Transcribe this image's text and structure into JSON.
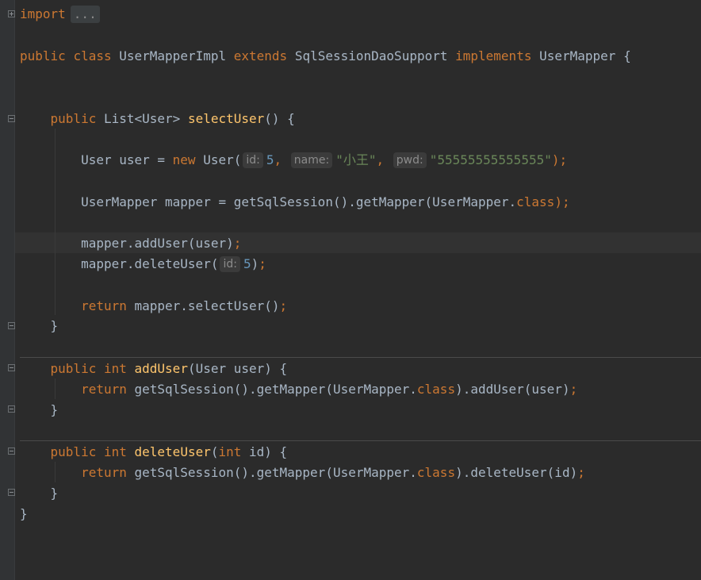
{
  "code": {
    "l_import_kw": "import",
    "l_import_fold": "...",
    "l_class_public": "public",
    "l_class_class": "class",
    "l_class_name": "UserMapperImpl",
    "l_class_extends": "extends",
    "l_class_super": "SqlSessionDaoSupport",
    "l_class_implements": "implements",
    "l_class_iface": "UserMapper",
    "l_class_brace": "{",
    "m1_public": "public",
    "m1_type": "List<User>",
    "m1_name": "selectUser",
    "m1_rest": "() {",
    "s1_type": "User user = ",
    "s1_new": "new",
    "s1_ctor": " User(",
    "s1_hint_id": "id:",
    "s1_id": "5",
    "s1_comma": ",",
    "s1_hint_name": "name:",
    "s1_name": "\"小王\"",
    "s1_hint_pwd": "pwd:",
    "s1_pwd": "\"55555555555555\"",
    "s1_end": ");",
    "s2_text": "UserMapper mapper = getSqlSession().getMapper(UserMapper.",
    "s2_class": "class",
    "s2_end": ");",
    "s3_text": "mapper.addUser(user)",
    "s3_end": ";",
    "s4_text": "mapper.deleteUser(",
    "s4_hint": "id:",
    "s4_num": "5",
    "s4_paren": ")",
    "s4_end": ";",
    "s5_return": "return",
    "s5_text": " mapper.selectUser()",
    "s5_end": ";",
    "close_brace": "}",
    "m2_public": "public",
    "m2_int": "int",
    "m2_name": "addUser",
    "m2_rest": "(User user) {",
    "m2_return": "return",
    "m2_body": " getSqlSession().getMapper(UserMapper.",
    "m2_class": "class",
    "m2_body2": ").addUser(user)",
    "m2_end": ";",
    "m3_public": "public",
    "m3_int": "int",
    "m3_name": "deleteUser",
    "m3_paren": "(",
    "m3_int2": "int",
    "m3_rest": " id) {",
    "m3_return": "return",
    "m3_body": " getSqlSession().getMapper(UserMapper.",
    "m3_class": "class",
    "m3_body2": ").deleteUser(id)",
    "m3_end": ";"
  },
  "colors": {
    "background": "#2b2b2b",
    "keyword": "#cc7832",
    "function": "#ffc66d",
    "string": "#6a8759",
    "number": "#6897bb",
    "text": "#a9b7c6"
  }
}
